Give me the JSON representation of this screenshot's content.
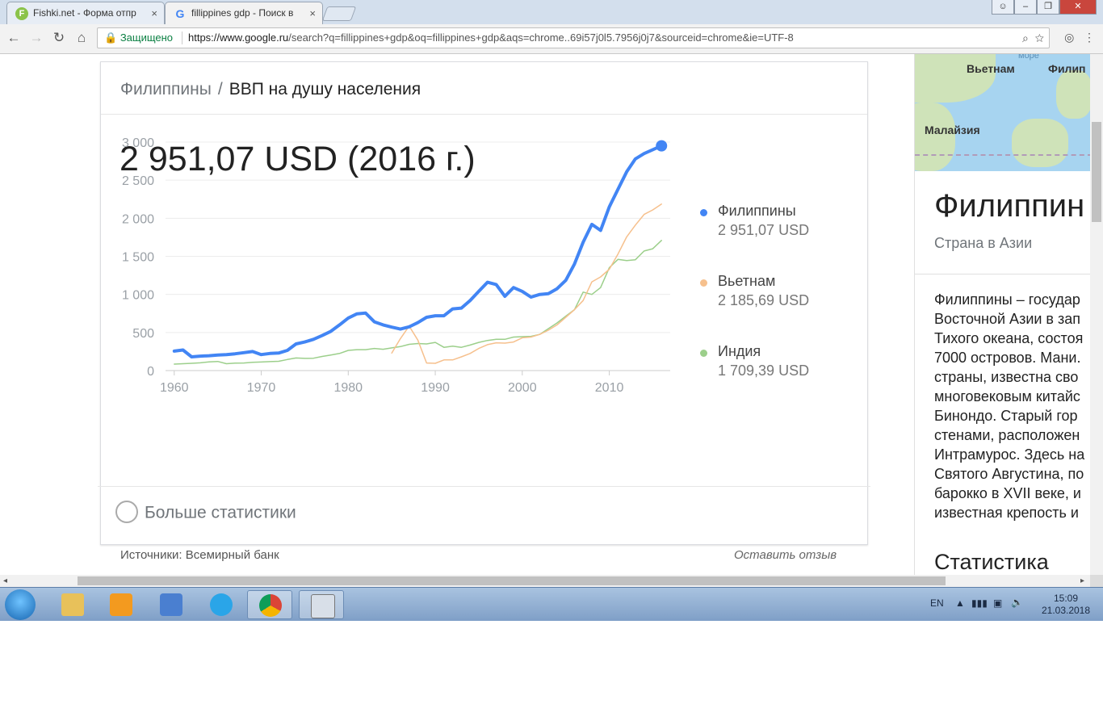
{
  "browser": {
    "tabs": [
      {
        "label": "Fishki.net - Форма отпр",
        "favicon": "F"
      },
      {
        "label": "fillippines gdp - Поиск в",
        "favicon": "G"
      }
    ],
    "secure_label": "Защищено",
    "url_domain": "https://www.google.ru",
    "url_rest": "/search?q=fillippines+gdp&oq=fillippines+gdp&aqs=chrome..69i57j0l5.7956j0j7&sourceid=chrome&ie=UTF-8"
  },
  "card": {
    "breadcrumb_country": "Филиппины",
    "breadcrumb_sep": "/",
    "breadcrumb_metric": "ВВП на душу населения",
    "headline_value": "2 951,07 USD (2016 г.)",
    "more_stats": "Больше статистики",
    "source": "Источники: Всемирный банк",
    "feedback": "Оставить отзыв"
  },
  "legend": [
    {
      "name": "Филиппины",
      "value": "2 951,07 USD",
      "color": "#4285f4"
    },
    {
      "name": "Вьетнам",
      "value": "2 185,69 USD",
      "color": "#f6c08d"
    },
    {
      "name": "Индия",
      "value": "1 709,39 USD",
      "color": "#9ccf8b"
    }
  ],
  "chart_data": {
    "type": "line",
    "title": "ВВП на душу населения",
    "xlabel": "",
    "ylabel": "",
    "x_ticks": [
      1960,
      1970,
      1980,
      1990,
      2000,
      2010
    ],
    "y_ticks": [
      0,
      500,
      1000,
      1500,
      2000,
      2500,
      3000
    ],
    "y_tick_labels": [
      "0",
      "500",
      "1 000",
      "1 500",
      "2 000",
      "2 500",
      "3 000"
    ],
    "xlim": [
      1959,
      2017
    ],
    "ylim": [
      0,
      3000
    ],
    "grid": true,
    "legend_position": "right",
    "series": [
      {
        "name": "Филиппины",
        "color": "#4285f4",
        "width": 4,
        "x": [
          1960,
          1961,
          1962,
          1963,
          1964,
          1965,
          1966,
          1967,
          1968,
          1969,
          1970,
          1971,
          1972,
          1973,
          1974,
          1975,
          1976,
          1977,
          1978,
          1979,
          1980,
          1981,
          1982,
          1983,
          1984,
          1985,
          1986,
          1987,
          1988,
          1989,
          1990,
          1991,
          1992,
          1993,
          1994,
          1995,
          1996,
          1997,
          1998,
          1999,
          2000,
          2001,
          2002,
          2003,
          2004,
          2005,
          2006,
          2007,
          2008,
          2009,
          2010,
          2011,
          2012,
          2013,
          2014,
          2015,
          2016
        ],
        "y": [
          255,
          270,
          180,
          190,
          195,
          205,
          210,
          220,
          235,
          250,
          210,
          225,
          230,
          265,
          350,
          375,
          410,
          460,
          515,
          600,
          690,
          745,
          755,
          640,
          600,
          570,
          545,
          575,
          630,
          700,
          720,
          720,
          810,
          820,
          920,
          1040,
          1160,
          1130,
          975,
          1090,
          1040,
          965,
          1000,
          1010,
          1075,
          1185,
          1400,
          1685,
          1920,
          1840,
          2150,
          2380,
          2610,
          2780,
          2850,
          2900,
          2951
        ]
      },
      {
        "name": "Вьетнам",
        "color": "#f6c08d",
        "width": 1.5,
        "x": [
          1985,
          1986,
          1987,
          1988,
          1989,
          1990,
          1991,
          1992,
          1993,
          1994,
          1995,
          1996,
          1997,
          1998,
          1999,
          2000,
          2001,
          2002,
          2003,
          2004,
          2005,
          2006,
          2007,
          2008,
          2009,
          2010,
          2011,
          2012,
          2013,
          2014,
          2015,
          2016
        ],
        "y": [
          230,
          420,
          585,
          400,
          100,
          95,
          140,
          140,
          180,
          225,
          290,
          340,
          365,
          360,
          375,
          430,
          440,
          475,
          530,
          600,
          700,
          800,
          920,
          1165,
          1230,
          1330,
          1530,
          1755,
          1910,
          2050,
          2110,
          2186
        ]
      },
      {
        "name": "Индия",
        "color": "#9ccf8b",
        "width": 1.5,
        "x": [
          1960,
          1961,
          1962,
          1963,
          1964,
          1965,
          1966,
          1967,
          1968,
          1969,
          1970,
          1971,
          1972,
          1973,
          1974,
          1975,
          1976,
          1977,
          1978,
          1979,
          1980,
          1981,
          1982,
          1983,
          1984,
          1985,
          1986,
          1987,
          1988,
          1989,
          1990,
          1991,
          1992,
          1993,
          1994,
          1995,
          1996,
          1997,
          1998,
          1999,
          2000,
          2001,
          2002,
          2003,
          2004,
          2005,
          2006,
          2007,
          2008,
          2009,
          2010,
          2011,
          2012,
          2013,
          2014,
          2015,
          2016
        ],
        "y": [
          85,
          90,
          95,
          102,
          115,
          120,
          90,
          98,
          100,
          108,
          112,
          118,
          122,
          145,
          165,
          160,
          162,
          185,
          205,
          225,
          265,
          275,
          275,
          290,
          280,
          298,
          315,
          345,
          355,
          350,
          370,
          305,
          320,
          305,
          335,
          370,
          395,
          410,
          410,
          440,
          445,
          450,
          475,
          550,
          625,
          715,
          800,
          1030,
          1000,
          1090,
          1350,
          1460,
          1445,
          1455,
          1570,
          1600,
          1709
        ]
      }
    ],
    "end_marker": {
      "x": 2016,
      "y": 2951
    }
  },
  "knowledge_panel": {
    "map_labels": [
      "Вьетнам",
      "Филип",
      "Малайзия",
      "море"
    ],
    "title": "Филиппин",
    "subtitle": "Страна в Азии",
    "description_lines": [
      "Филиппины – государ",
      "Восточной Азии в зап",
      "Тихого океана, состоя",
      "7000 островов. Мани.",
      "страны, известна сво",
      "многовековым китайс",
      "Бинондо. Старый гор",
      "стенами, расположен",
      "Интрамурос. Здесь на",
      "Святого Августина, по",
      "барокко в XVII веке, и",
      "известная крепость и"
    ],
    "stats_heading": "Статистика"
  },
  "taskbar": {
    "lang": "EN",
    "time": "15:09",
    "date": "21.03.2018"
  }
}
